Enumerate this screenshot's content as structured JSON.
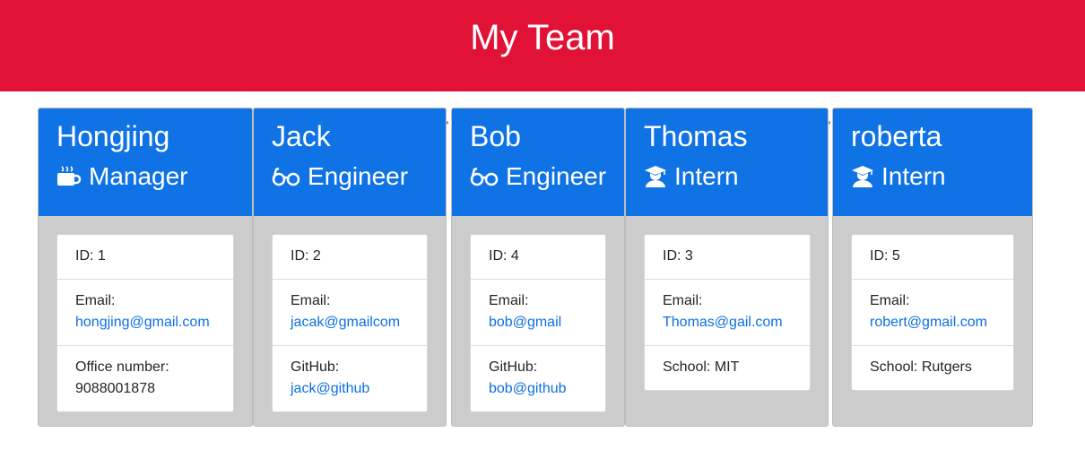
{
  "header": {
    "title": "My Team"
  },
  "separators": {
    "comma": ","
  },
  "cards": [
    {
      "name": "Hongjing",
      "role": "Manager",
      "role_icon": "coffee-icon",
      "id_text": "ID: 1",
      "email_label": "Email:",
      "email": "hongjing@gmail.com",
      "extra_label": "Office number:",
      "extra_value": "9088001878"
    },
    {
      "name": "Jack",
      "role": "Engineer",
      "role_icon": "glasses-icon",
      "id_text": "ID: 2",
      "email_label": "Email:",
      "email": "jacak@gmailcom",
      "extra_label": "GitHub:",
      "extra_value": "jack@github"
    },
    {
      "name": "Bob",
      "role": "Engineer",
      "role_icon": "glasses-icon",
      "id_text": "ID: 4",
      "email_label": "Email:",
      "email": "bob@gmail",
      "extra_label": "GitHub:",
      "extra_value": "bob@github"
    },
    {
      "name": "Thomas",
      "role": "Intern",
      "role_icon": "graduate-icon",
      "id_text": "ID: 3",
      "email_label": "Email:",
      "email": "Thomas@gail.com",
      "extra_text": "School: MIT"
    },
    {
      "name": "roberta",
      "role": "Intern",
      "role_icon": "graduate-icon",
      "id_text": "ID: 5",
      "email_label": "Email:",
      "email": "robert@gmail.com",
      "extra_text": "School: Rutgers"
    }
  ]
}
